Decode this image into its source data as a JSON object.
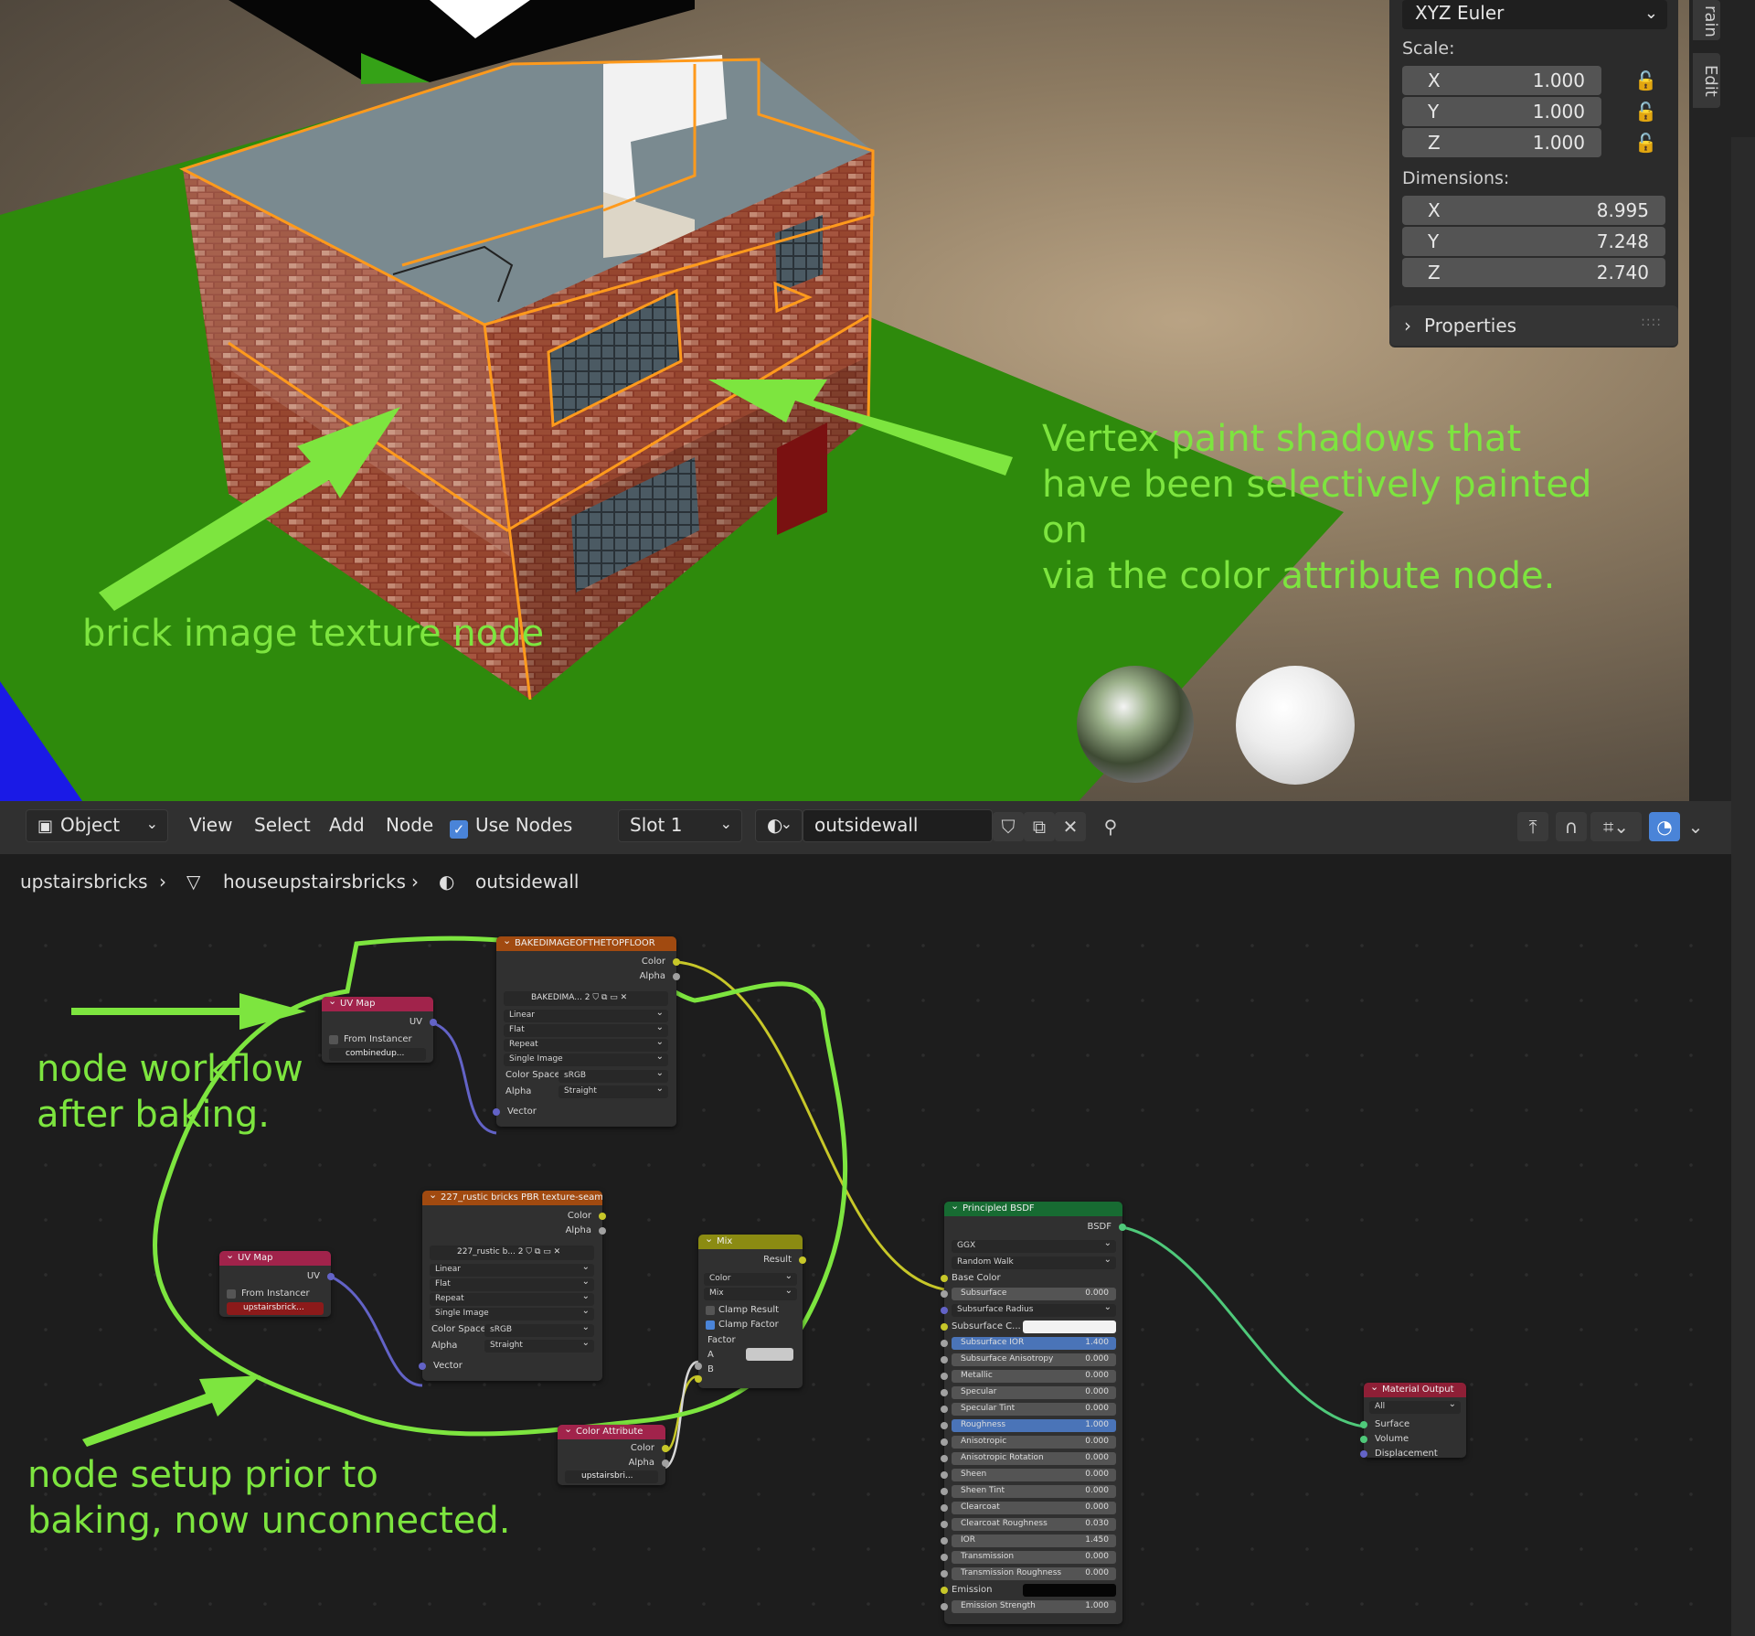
{
  "viewport": {
    "annotation_vertex": "Vertex paint shadows that\nhave been selectively painted on\nvia the color attribute node.",
    "annotation_brick": "brick image texture node"
  },
  "npanel": {
    "rotation_mode": "XYZ Euler",
    "scale_label": "Scale:",
    "scale": [
      {
        "axis": "X",
        "value": "1.000"
      },
      {
        "axis": "Y",
        "value": "1.000"
      },
      {
        "axis": "Z",
        "value": "1.000"
      }
    ],
    "dimensions_label": "Dimensions:",
    "dimensions": [
      {
        "axis": "X",
        "value": "8.995"
      },
      {
        "axis": "Y",
        "value": "7.248"
      },
      {
        "axis": "Z",
        "value": "2.740"
      }
    ],
    "properties_label": "Properties",
    "tab_rain": "rain",
    "tab_edit": "Edit"
  },
  "header": {
    "mode": "Object",
    "menu_view": "View",
    "menu_select": "Select",
    "menu_add": "Add",
    "menu_node": "Node",
    "use_nodes": "Use Nodes",
    "slot": "Slot 1",
    "material": "outsidewall"
  },
  "breadcrumb": {
    "object": "upstairsbricks",
    "mesh": "houseupstairsbricks",
    "material": "outsidewall"
  },
  "annotations": {
    "after": "node workflow\nafter baking.",
    "prior": "node setup prior to\nbaking, now unconnected."
  },
  "nodes": {
    "uv1": {
      "title": "UV Map",
      "out_uv": "UV",
      "from_instancer": "From Instancer",
      "map": "combinedup..."
    },
    "baked": {
      "title": "BAKEDIMAGEOFTHETOPFLOOR",
      "out_color": "Color",
      "out_alpha": "Alpha",
      "image": "BAKEDIMA...",
      "users": "2",
      "interp": "Linear",
      "proj": "Flat",
      "ext": "Repeat",
      "source": "Single Image",
      "cs_label": "Color Space",
      "cs": "sRGB",
      "alpha_label": "Alpha",
      "alpha": "Straight",
      "in_vector": "Vector"
    },
    "uv2": {
      "title": "UV Map",
      "out_uv": "UV",
      "from_instancer": "From Instancer",
      "map": "upstairsbrick..."
    },
    "bricks": {
      "title": "227_rustic bricks PBR texture-seamless...",
      "out_color": "Color",
      "out_alpha": "Alpha",
      "image": "227_rustic b...",
      "users": "2",
      "interp": "Linear",
      "proj": "Flat",
      "ext": "Repeat",
      "source": "Single Image",
      "cs_label": "Color Space",
      "cs": "sRGB",
      "alpha_label": "Alpha",
      "alpha": "Straight",
      "in_vector": "Vector"
    },
    "mix": {
      "title": "Mix",
      "out_result": "Result",
      "type": "Color",
      "blend": "Mix",
      "clamp_result": "Clamp Result",
      "clamp_factor": "Clamp Factor",
      "in_factor": "Factor",
      "in_a": "A",
      "in_b": "B"
    },
    "colattr": {
      "title": "Color Attribute",
      "out_color": "Color",
      "out_alpha": "Alpha",
      "layer": "upstairsbri..."
    },
    "bsdf": {
      "title": "Principled BSDF",
      "out_bsdf": "BSDF",
      "distribution": "GGX",
      "sss_method": "Random Walk",
      "base_color": "Base Color",
      "fields": [
        {
          "label": "Subsurface",
          "value": "0.000"
        },
        {
          "label": "Subsurface Radius",
          "value": ""
        },
        {
          "label": "Subsurface C...",
          "value": ""
        },
        {
          "label": "Subsurface IOR",
          "value": "1.400"
        },
        {
          "label": "Subsurface Anisotropy",
          "value": "0.000"
        },
        {
          "label": "Metallic",
          "value": "0.000"
        },
        {
          "label": "Specular",
          "value": "0.000"
        },
        {
          "label": "Specular Tint",
          "value": "0.000"
        },
        {
          "label": "Roughness",
          "value": "1.000"
        },
        {
          "label": "Anisotropic",
          "value": "0.000"
        },
        {
          "label": "Anisotropic Rotation",
          "value": "0.000"
        },
        {
          "label": "Sheen",
          "value": "0.000"
        },
        {
          "label": "Sheen Tint",
          "value": "0.000"
        },
        {
          "label": "Clearcoat",
          "value": "0.000"
        },
        {
          "label": "Clearcoat Roughness",
          "value": "0.030"
        },
        {
          "label": "IOR",
          "value": "1.450"
        },
        {
          "label": "Transmission",
          "value": "0.000"
        },
        {
          "label": "Transmission Roughness",
          "value": "0.000"
        },
        {
          "label": "Emission",
          "value": ""
        },
        {
          "label": "Emission Strength",
          "value": "1.000"
        }
      ]
    },
    "output": {
      "title": "Material Output",
      "target": "All",
      "in_surface": "Surface",
      "in_volume": "Volume",
      "in_displacement": "Displacement"
    }
  },
  "colors": {
    "annotation": "#7de53f",
    "selection_outline": "#ff9a1c",
    "ground": "#2e8a0c",
    "accent": "#4a84d8"
  }
}
